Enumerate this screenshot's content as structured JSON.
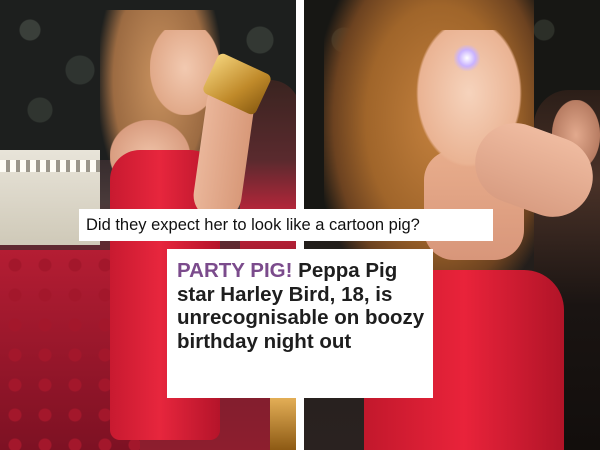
{
  "caption": {
    "text": "Did they expect her to look like a cartoon pig?"
  },
  "headline": {
    "kicker": "PARTY PIG!",
    "body": "Peppa Pig star Harley Bird, 18, is unrecognisable on boozy birthday night out",
    "kicker_color": "#7b4b8c"
  },
  "palette": {
    "dress_red": "#e7263d",
    "sofa_red": "#b41d33",
    "divider": "#ffffff"
  }
}
